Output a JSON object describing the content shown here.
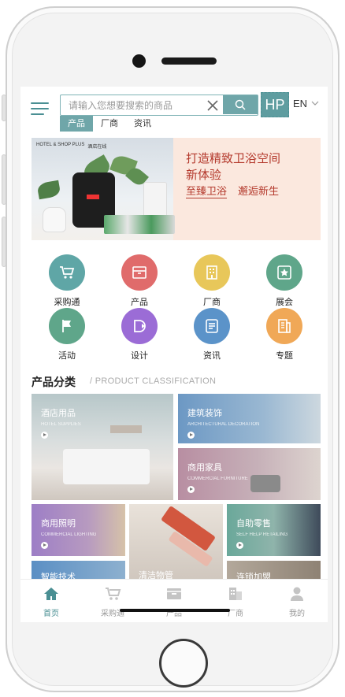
{
  "header": {
    "search_placeholder": "请输入您想要搜索的商品",
    "brand_logo": "HP",
    "language": "EN"
  },
  "tabs": [
    {
      "label": "产品",
      "active": true
    },
    {
      "label": "厂商",
      "active": false
    },
    {
      "label": "资讯",
      "active": false
    }
  ],
  "banner": {
    "brand_left": "HOTEL & SHOP PLUS",
    "brand_right": "酒店在线",
    "title_line1": "打造精致卫浴空间",
    "title_line2": "新体验",
    "sub_left": "至臻卫浴",
    "sub_right": "邂逅新生"
  },
  "icon_grid": [
    {
      "label": "采购通",
      "icon": "cart-icon",
      "color": "#5fa6a6"
    },
    {
      "label": "产品",
      "icon": "box-icon",
      "color": "#e06b6b"
    },
    {
      "label": "厂商",
      "icon": "building-icon",
      "color": "#e8c75a"
    },
    {
      "label": "展会",
      "icon": "star-badge-icon",
      "color": "#5fa68a"
    },
    {
      "label": "活动",
      "icon": "flag-icon",
      "color": "#5fa68a"
    },
    {
      "label": "设计",
      "icon": "design-icon",
      "color": "#9b6cd6"
    },
    {
      "label": "资讯",
      "icon": "news-icon",
      "color": "#5b93c9"
    },
    {
      "label": "专题",
      "icon": "topic-icon",
      "color": "#f0a857"
    }
  ],
  "section": {
    "title": "产品分类",
    "subtitle": "/ PRODUCT CLASSIFICATION"
  },
  "categories": [
    {
      "cn": "酒店用品",
      "en": "HOTEL SUPPLIES"
    },
    {
      "cn": "建筑装饰",
      "en": "ARCHITECTURAL DECORATION"
    },
    {
      "cn": "商用家具",
      "en": "COMMERCIAL FURNITURE"
    },
    {
      "cn": "商用照明",
      "en": "COMMERCIAL LIGHTING"
    },
    {
      "cn": "清洁物管",
      "en": ""
    },
    {
      "cn": "自助零售",
      "en": "SELF HELP RETAILING"
    },
    {
      "cn": "智能技术",
      "en": ""
    },
    {
      "cn": "连锁加盟",
      "en": ""
    }
  ],
  "bottom_nav": [
    {
      "label": "首页",
      "icon": "home-icon",
      "active": true
    },
    {
      "label": "采购通",
      "icon": "cart-icon",
      "active": false
    },
    {
      "label": "产品",
      "icon": "box-icon",
      "active": false
    },
    {
      "label": "厂商",
      "icon": "building-icon",
      "active": false
    },
    {
      "label": "我的",
      "icon": "user-icon",
      "active": false
    }
  ],
  "colors": {
    "accent": "#6fa6a9",
    "banner_text": "#b43a2d"
  }
}
